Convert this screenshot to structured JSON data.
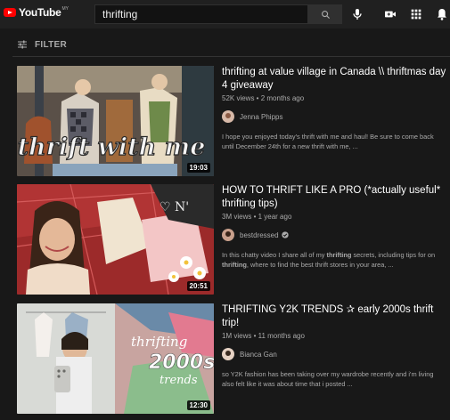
{
  "header": {
    "logo_text": "YouTube",
    "logo_region": "MY",
    "search_value": "thrifting",
    "icons": [
      "search-icon",
      "mic-icon",
      "create-video-icon",
      "apps-grid-icon",
      "notifications-bell-icon"
    ]
  },
  "filter": {
    "label": "FILTER",
    "icon": "filter-sliders-icon"
  },
  "results": [
    {
      "title": "thrifting at value village in Canada \\\\ thriftmas day 4 giveaway",
      "meta": "52K views • 2 months ago",
      "channel": "Jenna Phipps",
      "verified": false,
      "desc_line1": "I hope you enjoyed today's thrift with me and haul! Be sure to come back",
      "desc_line2": "until December 24th for a new thrift with me, ...",
      "duration": "19:03",
      "thumb_caption": "thrift with me"
    },
    {
      "title": "HOW TO THRIFT LIKE A PRO (*actually useful* thrifting tips)",
      "meta": "3M views • 1 year ago",
      "channel": "bestdressed",
      "verified": true,
      "desc_line1_a": "In this chatty video I share all of my ",
      "desc_line1_b": "thrifting",
      "desc_line1_c": " secrets, including tips for on",
      "desc_line2_a": "",
      "desc_line2_b": "thrifting",
      "desc_line2_c": ", where to find the best thrift stores in your area, ...",
      "duration": "20:51"
    },
    {
      "title": "THRIFTING Y2K TRENDS ✰ early 2000s thrift trip!",
      "meta": "1M views • 11 months ago",
      "channel": "Bianca Gan",
      "verified": false,
      "desc_line1": "so Y2K fashion has been taking over my wardrobe recently and i'm living",
      "desc_line2": "also felt like it was about time that i posted ...",
      "duration": "12:30",
      "thumb_caption_1": "thrifting",
      "thumb_caption_2": "2000s",
      "thumb_caption_3": "trends"
    }
  ],
  "colors": {
    "background": "#181818",
    "header": "#202020",
    "logo_red": "#ff0000",
    "secondary_text": "#aaaaaa"
  }
}
